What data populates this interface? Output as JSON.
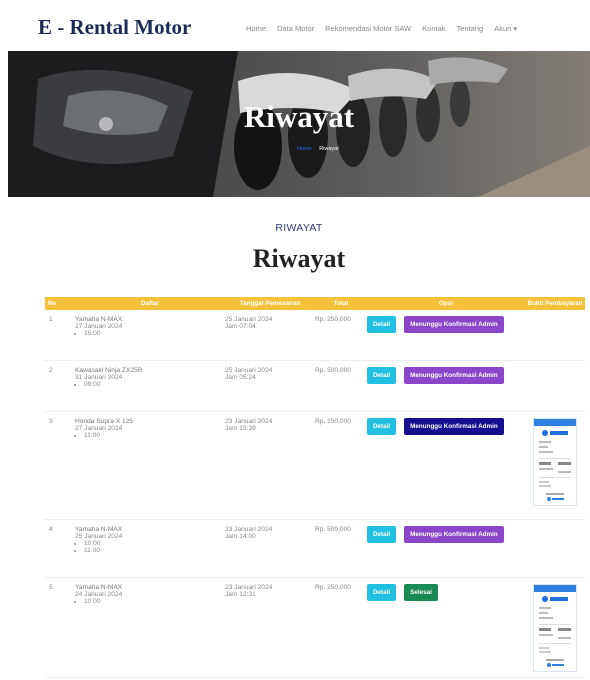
{
  "navbar": {
    "brand": "E - Rental Motor",
    "items": [
      "Home",
      "Data Motor",
      "Rekomendasi Motor SAW",
      "Kontak",
      "Tentang",
      "Akun ▾"
    ]
  },
  "hero": {
    "title": "Riwayat",
    "breadcrumb_home": "Home",
    "breadcrumb_current": "Riwayat"
  },
  "section": {
    "subtitle": "RIWAYAT",
    "title": "Riwayat"
  },
  "table": {
    "headers": [
      "No",
      "Daftar",
      "Tanggal Pemesanan",
      "Total",
      "Opsi",
      "Bukti Pembayaran"
    ],
    "rows": [
      {
        "no": "1",
        "motor": "Yamaha N-MAX",
        "date": "27 Januari 2024",
        "times": [
          "15:00"
        ],
        "order_date": "25 Januari 2024",
        "order_time": "Jam 07:04",
        "total": "Rp. 250,000",
        "detail": "Detail",
        "status": "Menunggu Konfirmasi Admin",
        "has_proof": false
      },
      {
        "no": "2",
        "motor": "Kawasaki Ninja ZX25R",
        "date": "31 Januari 2024",
        "times": [
          "09:00"
        ],
        "order_date": "25 Januari 2024",
        "order_time": "Jam 05:24",
        "total": "Rp. 500,000",
        "detail": "Detail",
        "status": "Menunggu Konfirmasi Admin",
        "has_proof": false
      },
      {
        "no": "3",
        "motor": "Honda Supra X 125",
        "date": "27 Januari 2024",
        "times": [
          "11:00"
        ],
        "order_date": "23 Januari 2024",
        "order_time": "Jam 15:39",
        "total": "Rp. 150,000",
        "detail": "Detail",
        "status": "Menunggu Konfirmasi Admin",
        "has_proof": true
      },
      {
        "no": "4",
        "motor": "Yamaha N-MAX",
        "date": "25 Januari 2024",
        "times": [
          "10:00",
          "11:00"
        ],
        "order_date": "23 Januari 2024",
        "order_time": "Jam 14:00",
        "total": "Rp. 500,000",
        "detail": "Detail",
        "status": "Menunggu Konfirmasi Admin",
        "has_proof": false
      },
      {
        "no": "5",
        "motor": "Yamaha N-MAX",
        "date": "24 Januari 2024",
        "times": [
          "10:00"
        ],
        "order_date": "23 Januari 2024",
        "order_time": "Jam 12:31",
        "total": "Rp. 250,000",
        "detail": "Detail",
        "status": "Selesai",
        "has_proof": true
      }
    ]
  }
}
